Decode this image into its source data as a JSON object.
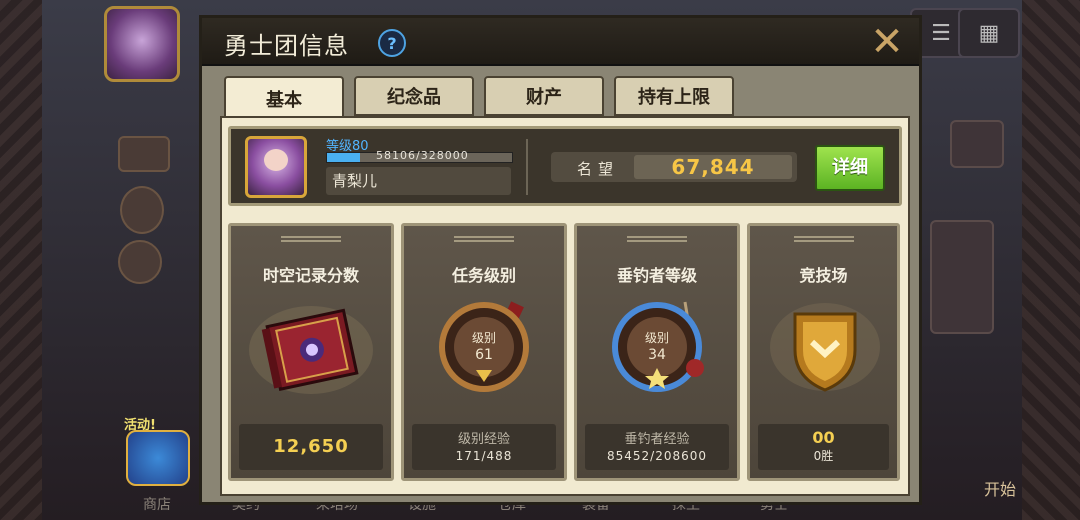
{
  "background": {
    "activity_label": "活动!",
    "nav": [
      "商店",
      "契约",
      "來培场",
      "设施",
      "仓库",
      "装备",
      "探生",
      "勇士"
    ],
    "start_label": "开始",
    "topbar_glyph": "等"
  },
  "dialog": {
    "title": "勇士团信息",
    "help_glyph": "?",
    "close_glyph": "✕",
    "tabs": [
      {
        "label": "基本",
        "active": true
      },
      {
        "label": "纪念品",
        "active": false
      },
      {
        "label": "财产",
        "active": false
      },
      {
        "label": "持有上限",
        "active": false
      }
    ],
    "profile": {
      "level_label": "等级80",
      "exp_text": "58106/328000",
      "exp_fraction": 0.177,
      "name": "青梨儿"
    },
    "reputation": {
      "label": "名望",
      "value": "67,844"
    },
    "detail_button": "详细",
    "cards": [
      {
        "title": "时空记录分数",
        "value": "12,650"
      },
      {
        "title": "任务级别",
        "badge_label": "级别",
        "badge_value": "61",
        "foot_label": "级别经验",
        "foot_value": "171/488"
      },
      {
        "title": "垂钓者等级",
        "badge_label": "级别",
        "badge_value": "34",
        "foot_label": "垂钓者经验",
        "foot_value": "85452/208600"
      },
      {
        "title": "竞技场",
        "foot_value": "00",
        "foot_sub": "0胜"
      }
    ],
    "colors": {
      "accent_gold": "#f4cf52",
      "button_green": "#7cc93a",
      "exp_blue": "#4ab0f0"
    }
  }
}
